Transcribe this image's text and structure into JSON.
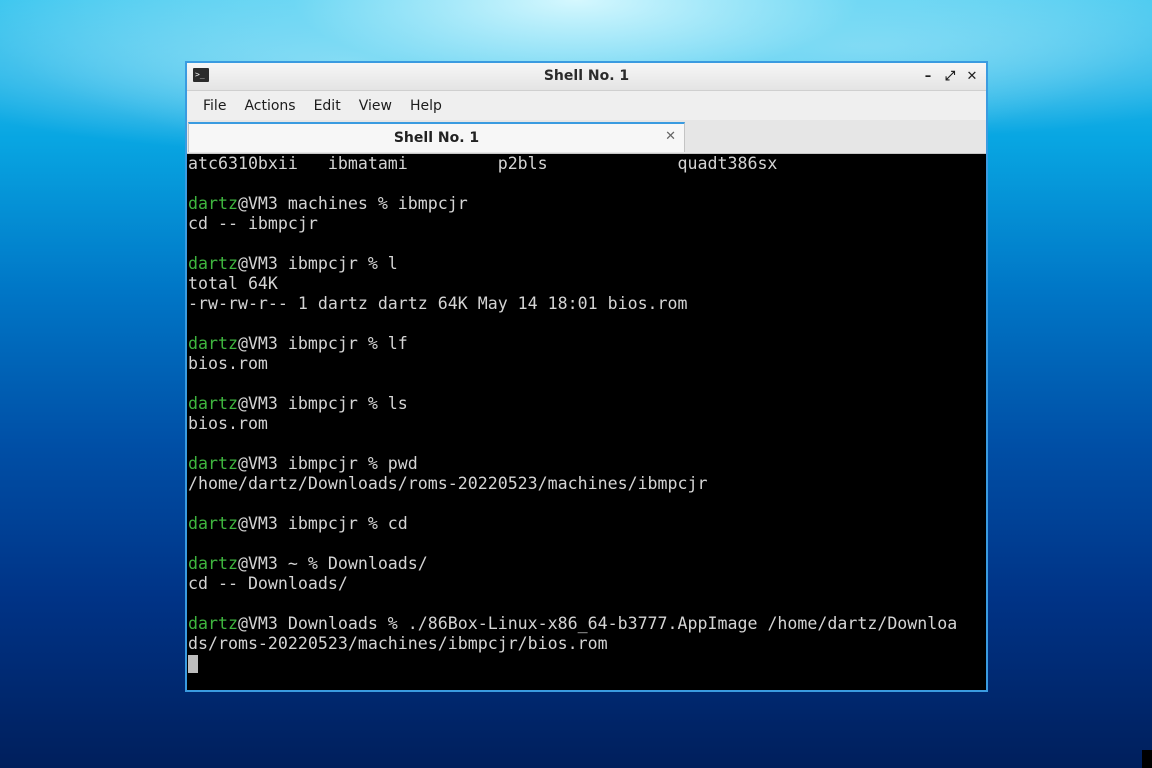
{
  "window": {
    "title": "Shell No. 1",
    "controls": {
      "minimize": "–",
      "maximize": "⤢",
      "close": "✕"
    }
  },
  "menu": [
    "File",
    "Actions",
    "Edit",
    "View",
    "Help"
  ],
  "tab": {
    "label": "Shell No. 1",
    "close": "✕"
  },
  "terminal": {
    "lines": [
      {
        "text": "atc6310bxii   ibmatami         p2bls             quadt386sx"
      },
      {
        "text": ""
      },
      {
        "user": "dartz",
        "rest": "@VM3 machines % ibmpcjr"
      },
      {
        "text": "cd -- ibmpcjr"
      },
      {
        "text": ""
      },
      {
        "user": "dartz",
        "rest": "@VM3 ibmpcjr % l"
      },
      {
        "text": "total 64K"
      },
      {
        "text": "-rw-rw-r-- 1 dartz dartz 64K May 14 18:01 bios.rom"
      },
      {
        "text": ""
      },
      {
        "user": "dartz",
        "rest": "@VM3 ibmpcjr % lf"
      },
      {
        "text": "bios.rom"
      },
      {
        "text": ""
      },
      {
        "user": "dartz",
        "rest": "@VM3 ibmpcjr % ls"
      },
      {
        "text": "bios.rom"
      },
      {
        "text": ""
      },
      {
        "user": "dartz",
        "rest": "@VM3 ibmpcjr % pwd"
      },
      {
        "text": "/home/dartz/Downloads/roms-20220523/machines/ibmpcjr"
      },
      {
        "text": ""
      },
      {
        "user": "dartz",
        "rest": "@VM3 ibmpcjr % cd"
      },
      {
        "text": ""
      },
      {
        "user": "dartz",
        "rest": "@VM3 ~ % Downloads/"
      },
      {
        "text": "cd -- Downloads/"
      },
      {
        "text": ""
      },
      {
        "user": "dartz",
        "rest": "@VM3 Downloads % ./86Box-Linux-x86_64-b3777.AppImage /home/dartz/Downloa"
      },
      {
        "text": "ds/roms-20220523/machines/ibmpcjr/bios.rom"
      }
    ]
  },
  "colors": {
    "prompt_user": "#3fb63f",
    "terminal_bg": "#000000",
    "terminal_fg": "#d4d4d4",
    "window_border": "#3a9be0"
  }
}
